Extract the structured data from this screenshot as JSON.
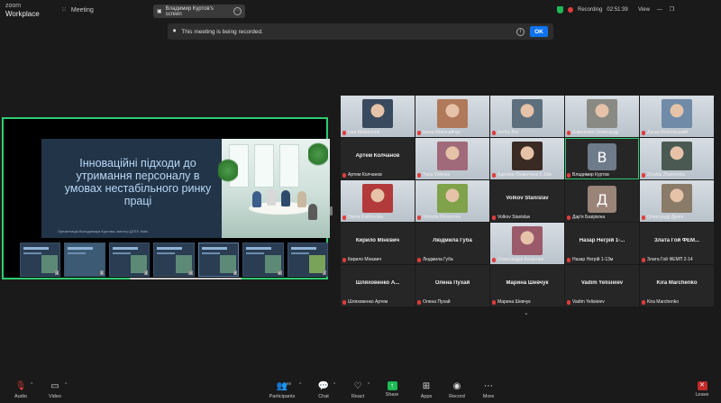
{
  "app": {
    "brand_top": "zoom",
    "brand_bottom": "Workplace",
    "meeting_label": "Meeting"
  },
  "share_pill": {
    "label": "Владимир Куртов's screen"
  },
  "status": {
    "recording_label": "Recording",
    "timer": "02:51:39",
    "view_label": "View"
  },
  "banner": {
    "message": "This meeting is being recorded.",
    "ok_label": "OK"
  },
  "slide": {
    "title": "Інноваційні підходи до утримання персоналу в умовах нестабільного ринку праці",
    "author": "Презентація Володимира Куртова, магістр ДТЕУ, Київ"
  },
  "thumbnails": [
    "1",
    "2",
    "3",
    "4",
    "5",
    "6",
    "7"
  ],
  "participants": [
    {
      "name": "Ivan Makarchuk",
      "type": "video",
      "color": "#3a4a5e"
    },
    {
      "name": "Ірина Миколайчук",
      "type": "video",
      "color": "#b07a5a"
    },
    {
      "name": "Serhiy Bal",
      "type": "video",
      "color": "#5d6f7d"
    },
    {
      "name": "Коваленко Олександр",
      "type": "video",
      "color": "#8a8a84"
    },
    {
      "name": "Данил Козловський",
      "type": "video",
      "color": "#6f8ba8"
    },
    {
      "name": "Артем Колчанов",
      "display": "Артем Колчанов",
      "type": "name"
    },
    {
      "name": "Yana Volkova",
      "type": "video",
      "color": "#a06a7a"
    },
    {
      "name": "Аделіна Плакотнюк 1-13м",
      "type": "video",
      "color": "#3a2a24"
    },
    {
      "name": "Владимир Куртов",
      "type": "initial",
      "initial": "В",
      "color": "#6e7b8a",
      "active": true
    },
    {
      "name": "Zinaida Zhukovska",
      "type": "video",
      "color": "#4a5a52"
    },
    {
      "name": "Olena Kakhovska",
      "type": "video",
      "color": "#b33a3a"
    },
    {
      "name": "Viktoriia Khmurova",
      "type": "video",
      "color": "#7fa24a"
    },
    {
      "name": "Volkov Stanislav",
      "display": "Volkov Stanislav",
      "type": "name"
    },
    {
      "name": "Дар'я Базірікіна",
      "type": "initial",
      "initial": "Д",
      "color": "#9a8478"
    },
    {
      "name": "Олександр Дрига",
      "type": "video",
      "color": "#8a7a68"
    },
    {
      "name": "Кирило Мінєвич",
      "display": "Кирило Мінєвич",
      "type": "name"
    },
    {
      "name": "Людмила Губа",
      "display": "Людмила Губа",
      "type": "name"
    },
    {
      "name": "Олександра Баганова",
      "type": "video",
      "color": "#9a5a6a"
    },
    {
      "name": "Назар Негрій 1-13м",
      "display": "Назар Негрій 1-...",
      "type": "name"
    },
    {
      "name": "Злата Гой ФЕМП 2-14",
      "display": "Злата Гой ФЕМ...",
      "type": "name"
    },
    {
      "name": "Шляховенко Артем",
      "display": "Шляховенко А...",
      "type": "name"
    },
    {
      "name": "Олена Пухай",
      "display": "Олена Пухай",
      "type": "name"
    },
    {
      "name": "Марина Шевчук",
      "display": "Марина Шевчук",
      "type": "name"
    },
    {
      "name": "Vadim Yelisieiev",
      "display": "Vadim Yelisieiev",
      "type": "name"
    },
    {
      "name": "Kira Marchenko",
      "display": "Kira Marchenko",
      "type": "name"
    }
  ],
  "toolbar": {
    "audio": "Audio",
    "video": "Video",
    "participants": "Participants",
    "participants_count": "69",
    "chat": "Chat",
    "react": "React",
    "share": "Share",
    "apps": "Apps",
    "record": "Record",
    "more": "More",
    "leave": "Leave"
  },
  "icons": {
    "mic": "microphone-muted-icon",
    "camera": "camera-icon",
    "people": "people-icon",
    "chat": "chat-bubble-icon",
    "heart": "heart-icon",
    "share": "share-arrow-icon",
    "apps": "apps-grid-icon",
    "record": "record-icon",
    "more": "more-dots-icon",
    "leave": "leave-icon"
  }
}
